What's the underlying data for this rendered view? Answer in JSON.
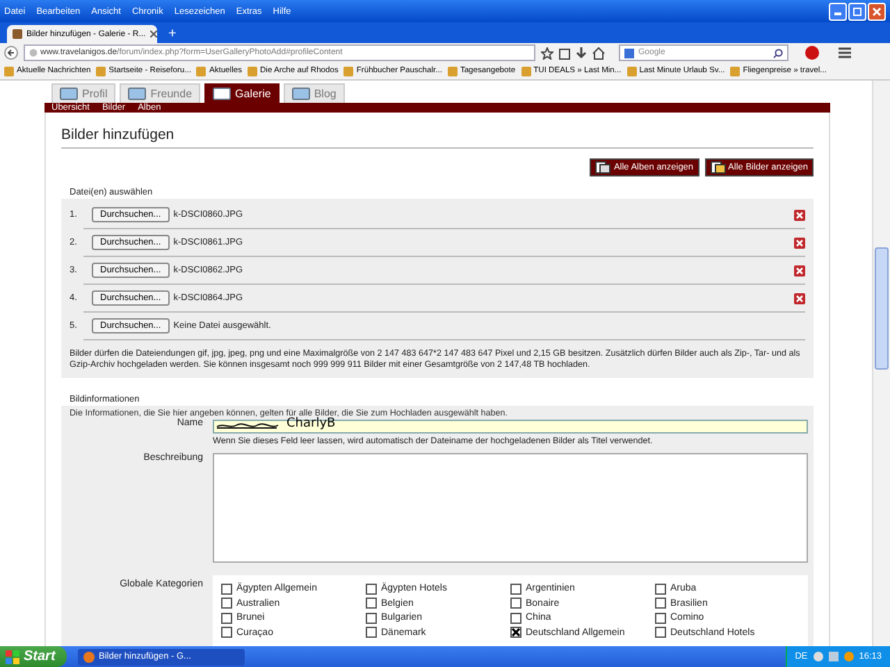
{
  "window": {
    "menu": [
      "Datei",
      "Bearbeiten",
      "Ansicht",
      "Chronik",
      "Lesezeichen",
      "Extras",
      "Hilfe"
    ]
  },
  "browser_tab": {
    "title": "Bilder hinzufügen - Galerie - R...",
    "new_tab": "+"
  },
  "address_bar": {
    "host": "www.travelanigos.de",
    "path": "/forum/index.php?form=UserGalleryPhotoAdd#profileContent"
  },
  "search": {
    "placeholder": "Google"
  },
  "bookmarks": [
    "Aktuelle Nachrichten",
    "Startseite - Reiseforu...",
    "Aktuelles",
    "Die Arche auf Rhodos",
    "Frühbucher Pauschalr...",
    "Tagesangebote",
    "TUI DEALS » Last Min...",
    "Last Minute Urlaub Sv...",
    "Fliegenpreise » travel..."
  ],
  "profile_tabs": [
    {
      "label": "Profil",
      "selected": false
    },
    {
      "label": "Freunde",
      "selected": false
    },
    {
      "label": "Galerie",
      "selected": true
    },
    {
      "label": "Blog",
      "selected": false
    }
  ],
  "subnav": [
    "Übersicht",
    "Bilder",
    "Alben"
  ],
  "heading": "Bilder hinzufügen",
  "action_buttons": [
    "Alle Alben anzeigen",
    "Alle Bilder anzeigen"
  ],
  "files": {
    "legend": "Datei(en) auswählen",
    "rows": [
      {
        "number": "1.",
        "button": "Durchsuchen...",
        "filename": "k-DSCI0860.JPG",
        "removable": true
      },
      {
        "number": "2.",
        "button": "Durchsuchen...",
        "filename": "k-DSCI0861.JPG",
        "removable": true
      },
      {
        "number": "3.",
        "button": "Durchsuchen...",
        "filename": "k-DSCI0862.JPG",
        "removable": true
      },
      {
        "number": "4.",
        "button": "Durchsuchen...",
        "filename": "k-DSCI0864.JPG",
        "removable": true
      },
      {
        "number": "5.",
        "button": "Durchsuchen...",
        "filename": "Keine Datei ausgewählt.",
        "removable": false
      }
    ],
    "note": "Bilder dürfen die Dateiendungen gif, jpg, jpeg, png und eine Maximalgröße von 2 147 483 647*2 147 483 647 Pixel und 2,15 GB besitzen. Zusätzlich dürfen Bilder auch als Zip-, Tar- und als Gzip-Archiv hochgeladen werden. Sie können insgesamt noch 999 999 911 Bilder mit einer Gesamtgröße von 2 147,48 TB hochladen."
  },
  "info": {
    "legend": "Bildinformationen",
    "intro": "Die Informationen, die Sie hier angeben können, gelten für alle Bilder, die Sie zum Hochladen ausgewählt haben.",
    "name_label": "Name",
    "name_hint": "Wenn Sie dieses Feld leer lassen, wird automatisch der Dateiname der hochgeladenen Bilder als Titel verwendet.",
    "description_label": "Beschreibung",
    "categories_label": "Globale Kategorien",
    "categories": [
      {
        "label": "Ägypten Allgemein",
        "checked": false
      },
      {
        "label": "Ägypten Hotels",
        "checked": false
      },
      {
        "label": "Argentinien",
        "checked": false
      },
      {
        "label": "Aruba",
        "checked": false
      },
      {
        "label": "Australien",
        "checked": false
      },
      {
        "label": "Belgien",
        "checked": false
      },
      {
        "label": "Bonaire",
        "checked": false
      },
      {
        "label": "Brasilien",
        "checked": false
      },
      {
        "label": "Brunei",
        "checked": false
      },
      {
        "label": "Bulgarien",
        "checked": false
      },
      {
        "label": "China",
        "checked": false
      },
      {
        "label": "Comino",
        "checked": false
      },
      {
        "label": "Curaçao",
        "checked": false
      },
      {
        "label": "Dänemark",
        "checked": false
      },
      {
        "label": "Deutschland Allgemein",
        "checked": true
      },
      {
        "label": "Deutschland Hotels",
        "checked": false
      }
    ]
  },
  "annotation": {
    "handwriting": "CharlyB"
  },
  "taskbar": {
    "start": "Start",
    "task": "Bilder hinzufügen - G...",
    "language": "DE",
    "clock": "16:13"
  }
}
